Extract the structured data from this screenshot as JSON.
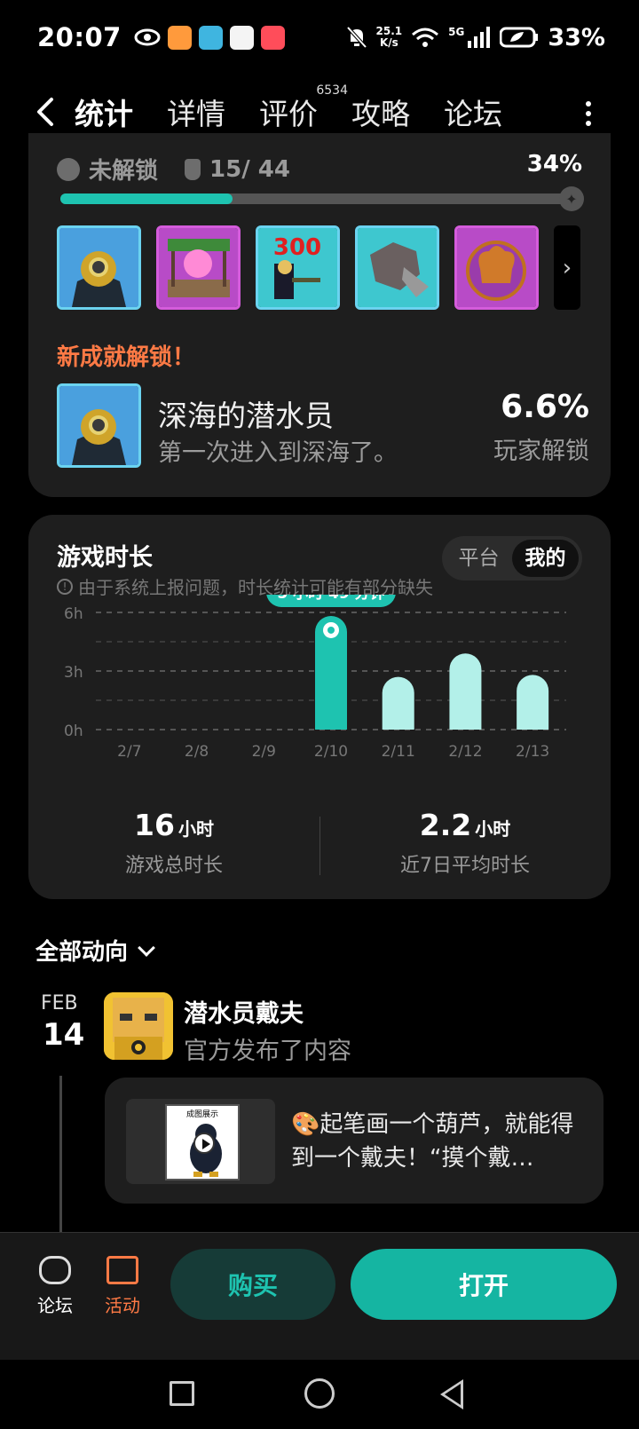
{
  "status": {
    "time": "20:07",
    "net_speed_value": "25.1",
    "net_speed_unit": "K/s",
    "network": "5G",
    "battery": "33%"
  },
  "nav": {
    "tabs": [
      {
        "label": "统计",
        "active": true
      },
      {
        "label": "详情"
      },
      {
        "label": "评价",
        "badge": "6534"
      },
      {
        "label": "攻略"
      },
      {
        "label": "论坛"
      }
    ]
  },
  "achievements": {
    "locked_label": "未解锁",
    "count": "15/ 44",
    "percent": "34%",
    "progress": 0.34,
    "new_unlock_label": "新成就解锁！",
    "latest": {
      "name": "深海的潜水员",
      "desc": "第一次进入到深海了。",
      "rate": "6.6%",
      "rate_label": "玩家解锁"
    }
  },
  "playtime": {
    "title": "游戏时长",
    "note": "由于系统上报问题，时长统计可能有部分缺失",
    "toggle": {
      "platform": "平台",
      "mine": "我的"
    },
    "highlight_label": "5 小时 49 分钟",
    "total": {
      "value": "16",
      "unit": "小时",
      "label": "游戏总时长"
    },
    "average": {
      "value": "2.2",
      "unit": "小时",
      "label": "近7日平均时长"
    }
  },
  "chart_data": {
    "type": "bar",
    "categories": [
      "2/7",
      "2/8",
      "2/9",
      "2/10",
      "2/11",
      "2/12",
      "2/13"
    ],
    "values": [
      0,
      0,
      0,
      5.82,
      2.7,
      3.9,
      2.8
    ],
    "y_ticks": [
      "0h",
      "3h",
      "6h"
    ],
    "ylim": [
      0,
      6
    ],
    "highlight_index": 3,
    "grid": true
  },
  "feed": {
    "title": "全部动向",
    "date_month": "FEB",
    "date_day": "14",
    "author": "潜水员戴夫",
    "author_sub": "官方发布了内容",
    "post_thumb_caption": "成图展示",
    "post_text": "🎨起笔画一个葫芦，就能得到一个戴夫！“摸个戴…"
  },
  "bottom": {
    "forum": "论坛",
    "events": "活动",
    "buy": "购买",
    "open": "打开"
  },
  "colors": {
    "accent": "#1ec3b0",
    "bar_light": "#b3f0e9",
    "orange": "#ff7a45"
  }
}
